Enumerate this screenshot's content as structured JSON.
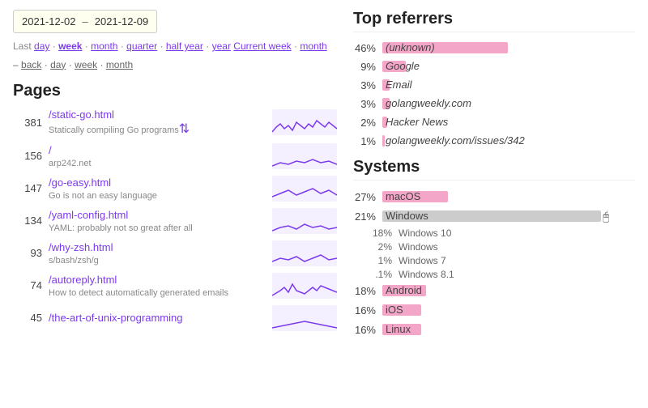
{
  "header": {
    "date_start": "2021-12-02",
    "date_separator": "–",
    "date_end": "2021-12-09"
  },
  "period_links": {
    "last": "Last",
    "day1": "day",
    "dot1": "·",
    "week1": "week",
    "dot2": "·",
    "month1": "month",
    "dot3": "·",
    "quarter": "quarter",
    "dot4": "·",
    "half_year": "half year",
    "dot5": "·",
    "year": "year",
    "current_week_label": "Current week",
    "dot6": "·",
    "month2": "month"
  },
  "back_links": {
    "dash": "–",
    "back": "back",
    "dot1": "·",
    "day": "day",
    "dot2": "·",
    "week": "week",
    "dot3": "·",
    "month": "month"
  },
  "pages_title": "Pages",
  "pages": [
    {
      "count": "381",
      "link": "/static-go.html",
      "desc": "Statically compiling Go programs",
      "has_sort": true
    },
    {
      "count": "156",
      "link": "/",
      "desc": "arp242.net",
      "has_sort": false
    },
    {
      "count": "147",
      "link": "/go-easy.html",
      "desc": "Go is not an easy language",
      "has_sort": false
    },
    {
      "count": "134",
      "link": "/yaml-config.html",
      "desc": "YAML: probably not so great after all",
      "has_sort": false
    },
    {
      "count": "93",
      "link": "/why-zsh.html",
      "desc": "s/bash/zsh/g",
      "has_sort": false
    },
    {
      "count": "74",
      "link": "/autoreply.html",
      "desc": "How to detect automatically generated emails",
      "has_sort": false
    },
    {
      "count": "45",
      "link": "/the-art-of-unix-programming",
      "desc": "",
      "has_sort": false
    }
  ],
  "referrers_title": "Top referrers",
  "referrers": [
    {
      "pct": "46%",
      "label": "(unknown)",
      "bar_pct": 100,
      "italic": true
    },
    {
      "pct": "9%",
      "label": "Google",
      "bar_pct": 19,
      "italic": true
    },
    {
      "pct": "3%",
      "label": "Email",
      "bar_pct": 6,
      "italic": false
    },
    {
      "pct": "3%",
      "label": "golangweekly.com",
      "bar_pct": 6,
      "italic": false
    },
    {
      "pct": "2%",
      "label": "Hacker News",
      "bar_pct": 4,
      "italic": true
    },
    {
      "pct": "1%",
      "label": "golangweekly.com/issues/342",
      "bar_pct": 2,
      "italic": false
    }
  ],
  "systems_title": "Systems",
  "systems": [
    {
      "pct": "27%",
      "label": "macOS",
      "bar_pct": 27,
      "pink": true,
      "sub": []
    },
    {
      "pct": "21%",
      "label": "Windows",
      "bar_pct": 90,
      "pink": false,
      "sub": [
        {
          "pct": "18%",
          "label": "Windows 10"
        },
        {
          "pct": "2%",
          "label": "Windows"
        },
        {
          "pct": "1%",
          "label": "Windows 7"
        },
        {
          "pct": ".1%",
          "label": "Windows 8.1"
        }
      ]
    },
    {
      "pct": "18%",
      "label": "Android",
      "bar_pct": 18,
      "pink": true,
      "sub": []
    },
    {
      "pct": "16%",
      "label": "iOS",
      "bar_pct": 16,
      "pink": true,
      "sub": []
    },
    {
      "pct": "16%",
      "label": "Linux",
      "bar_pct": 16,
      "pink": true,
      "sub": []
    }
  ],
  "sparklines": [
    "M0,28 L5,22 L10,18 L15,24 L20,20 L25,26 L30,16 L35,20 L40,24 L45,18 L50,22 L55,14 L60,18 L65,22 L70,16 L75,20 L80,24",
    "M0,28 L10,24 L20,26 L30,22 L40,24 L50,20 L60,24 L70,22 L80,26",
    "M0,26 L10,22 L20,18 L30,24 L40,20 L50,16 L60,22 L70,18 L80,24",
    "M0,28 L10,24 L20,22 L30,26 L40,20 L50,24 L60,22 L70,26 L80,24",
    "M0,26 L10,22 L20,24 L30,20 L40,26 L50,22 L60,18 L70,24 L80,22",
    "M0,28 L10,22 L15,18 L20,24 L25,14 L30,22 L40,26 L50,18 L55,22 L60,16 L70,20 L80,24",
    "M0,28 L20,24 L40,20 L60,24 L80,28"
  ]
}
